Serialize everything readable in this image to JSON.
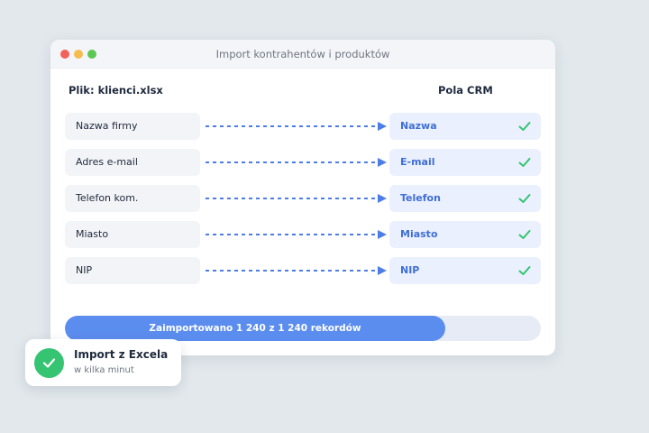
{
  "window": {
    "title": "Import kontrahentów i produktów"
  },
  "columns": {
    "file_label": "Plik: klienci.xlsx",
    "crm_label": "Pola CRM"
  },
  "mappings": [
    {
      "source": "Nazwa firmy",
      "target": "Nazwa"
    },
    {
      "source": "Adres e-mail",
      "target": "E-mail"
    },
    {
      "source": "Telefon kom.",
      "target": "Telefon"
    },
    {
      "source": "Miasto",
      "target": "Miasto"
    },
    {
      "source": "NIP",
      "target": "NIP"
    }
  ],
  "progress": {
    "label": "Zaimportowano 1 240 z 1 240 rekordów",
    "fill_fraction": 0.8
  },
  "toast": {
    "title": "Import z Excela",
    "subtitle": "w kilka minut"
  },
  "colors": {
    "accent": "#5b8def",
    "success": "#34c472"
  }
}
